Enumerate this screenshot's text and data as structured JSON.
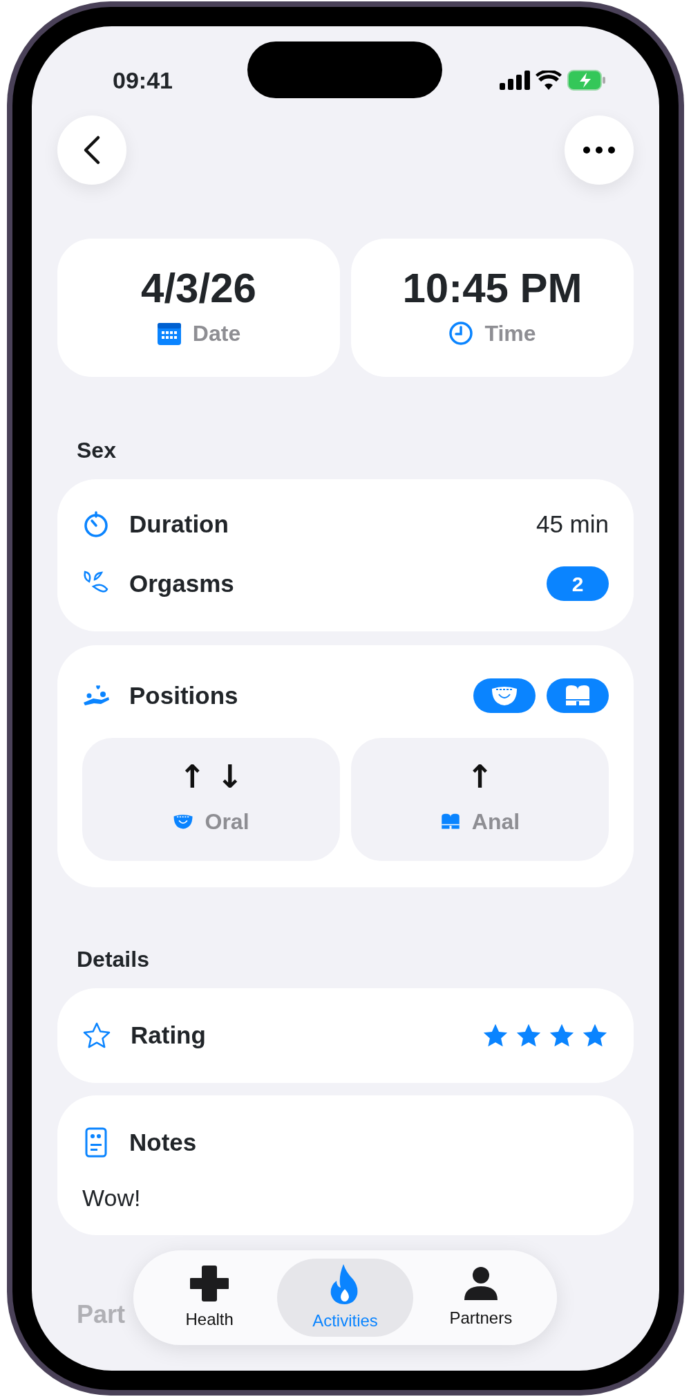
{
  "status_bar": {
    "time": "09:41"
  },
  "date_time": [
    {
      "kind": "date",
      "value": "4/3/26",
      "label": "Date"
    },
    {
      "kind": "time",
      "value": "10:45 PM",
      "label": "Time"
    }
  ],
  "sex": {
    "title": "Sex",
    "duration": {
      "label": "Duration",
      "value": "45 min"
    },
    "orgasms": {
      "label": "Orgasms",
      "count": "2"
    },
    "positions": {
      "label": "Positions",
      "chips": [
        {
          "kind": "oral"
        },
        {
          "kind": "anal"
        }
      ],
      "items": [
        {
          "kind": "oral",
          "label": "Oral",
          "arrows": [
            "↑",
            "↓"
          ]
        },
        {
          "kind": "anal",
          "label": "Anal",
          "arrows": [
            "↑"
          ]
        }
      ]
    }
  },
  "details": {
    "title": "Details",
    "rating": {
      "label": "Rating",
      "stars": 4
    },
    "notes": {
      "label": "Notes",
      "text": "Wow!"
    }
  },
  "partners_section": {
    "title": "Part"
  },
  "tab_bar": [
    {
      "kind": "health",
      "label": "Health",
      "selected": false
    },
    {
      "kind": "activities",
      "label": "Activities",
      "selected": true
    },
    {
      "kind": "partners",
      "label": "Partners",
      "selected": false
    }
  ]
}
